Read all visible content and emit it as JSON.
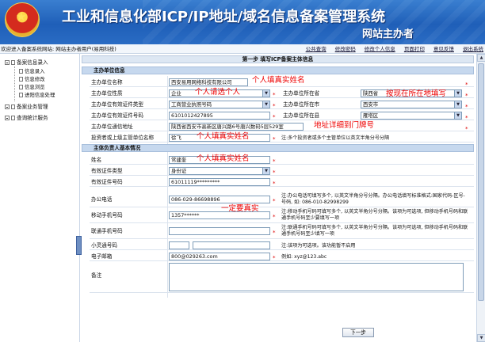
{
  "header": {
    "title": "工业和信息化部ICP/IP地址/域名信息备案管理系统",
    "subtitle": "网站主办者"
  },
  "toolbar": {
    "welcome": "欢迎进入备案系统网站: 网站主办者用户(易用科技)",
    "links": [
      "公共查询",
      "修改密码",
      "修改个人信息",
      "页面打印",
      "意见反馈",
      "退出系统"
    ]
  },
  "sidebar": {
    "groups": [
      {
        "label": "备案信息录入",
        "items": [
          "信息录入",
          "信息修改",
          "信息浏览",
          "进阳信息处理"
        ]
      },
      {
        "label": "备案业务管理",
        "items": []
      },
      {
        "label": "查询统计服务",
        "items": []
      }
    ]
  },
  "form": {
    "step_title": "第一步  填写ICP备案主体信息",
    "section1": "主办单位信息",
    "section2": "主体负责人基本情况",
    "unit_name": {
      "label": "主办单位名称",
      "value": "西安易用网络科技有限公司"
    },
    "unit_nature": {
      "label": "主办单位性质",
      "value": "企业"
    },
    "province": {
      "label": "主办单位所在省",
      "value": "陕西省"
    },
    "cert_type": {
      "label": "主办单位有效证件类型",
      "value": "工商营业执照号码"
    },
    "city": {
      "label": "主办单位所在市",
      "value": "西安市"
    },
    "cert_no": {
      "label": "主办单位有效证件号码",
      "value": "6101012427895"
    },
    "county": {
      "label": "主办单位所在县",
      "value": "雁塔区"
    },
    "address": {
      "label": "主办单位通信地址",
      "value": "陕西省西安市高新区唐兴路6号唐兴数码5层529室"
    },
    "investor": {
      "label": "投资者或上级主管单位名称",
      "value": "徐飞",
      "note": "注:多个投资者或多个主管单位以英文半角分号分隔"
    },
    "person_name": {
      "label": "姓名",
      "value": "常建奎"
    },
    "person_cert_type": {
      "label": "有效证件类型",
      "value": "身份证"
    },
    "person_cert_no": {
      "label": "有效证件号码",
      "value": "61011119*********"
    },
    "office_phone": {
      "label": "办公电话",
      "value": "086-029-86698896",
      "note": "注:办公电话可填写多个, 以英文半角分号分隔。办公电话填写标准格式:国家代码-区号-号码, 如: 086-010-82998299"
    },
    "mobile": {
      "label": "移动手机号码",
      "value": "1357******",
      "note": "注:移动手机号码可填写多个, 以英文半角分号分隔。该项为可选项, 但移动手机号码和联通手机号码至少要填写一项"
    },
    "unicom": {
      "label": "联通手机号码",
      "value": "",
      "note": "注:联通手机号码可填写多个, 以英文半角分号分隔。该项为可选项, 但移动手机号码和联通手机号码至少填写一项"
    },
    "phs": {
      "label": "小灵通号码",
      "value": "",
      "note": "注:该项为可选项。该功能暂不启用"
    },
    "email": {
      "label": "电子邮箱",
      "value": "800@029263.com",
      "note": "例如: xyz@123.abc"
    },
    "remark": {
      "label": "备注",
      "value": ""
    },
    "required_mark": "*",
    "next_button": "下一步"
  },
  "annotations": {
    "a1": "个人填真实姓名",
    "a2": "个人请选个人",
    "a3": "按现在所在地填写",
    "a4": "地址详细到门牌号",
    "a5": "个人填真实姓名",
    "a6": "个人填真实姓名",
    "a7": "一定要真实"
  },
  "colors": {
    "header": "#1f5fb8",
    "section": "#c6d8ee",
    "annotation": "#ee0000",
    "required": "#dd0000"
  }
}
